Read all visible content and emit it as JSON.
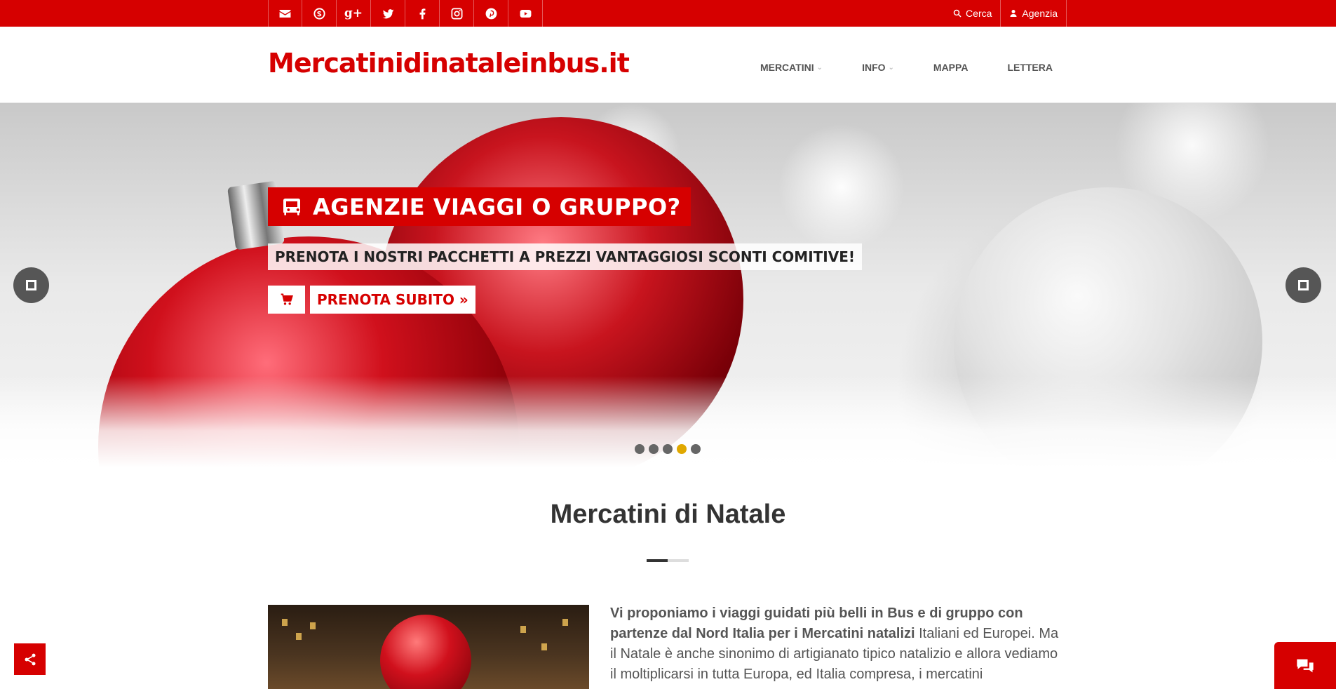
{
  "top_bar": {
    "social_icons": [
      "email-icon",
      "skype-icon",
      "google-plus-icon",
      "twitter-icon",
      "facebook-icon",
      "instagram-icon",
      "pinterest-icon",
      "youtube-icon"
    ],
    "google_plus_glyph": "g+",
    "search_label": "Cerca",
    "agency_label": "Agenzia"
  },
  "header": {
    "logo": "Mercatinidinataleinbus.it",
    "nav": [
      {
        "label": "MERCATINI",
        "dropdown": true
      },
      {
        "label": "INFO",
        "dropdown": true
      },
      {
        "label": "MAPPA",
        "dropdown": false
      },
      {
        "label": "LETTERA",
        "dropdown": false
      }
    ]
  },
  "hero": {
    "title": "AGENZIE VIAGGI O GRUPPO?",
    "subtitle": "PRENOTA I NOSTRI PACCHETTI A PREZZI VANTAGGIOSI SCONTI COMITIVE!",
    "cta_label": "PRENOTA SUBITO »",
    "slides_total": 5,
    "active_slide": 4
  },
  "content": {
    "section_title": "Mercatini di Natale",
    "intro_bold": "Vi proponiamo i viaggi guidati più belli in Bus e di gruppo con partenze dal Nord Italia per i Mercatini natalizi",
    "intro_text": " Italiani ed Europei. Ma il Natale è anche sinonimo di artigianato tipico natalizio e allora vediamo il moltiplicarsi in tutta Europa, ed Italia compresa, i mercatini"
  },
  "colors": {
    "brand_red": "#d60000",
    "active_dot": "#e0a800"
  }
}
